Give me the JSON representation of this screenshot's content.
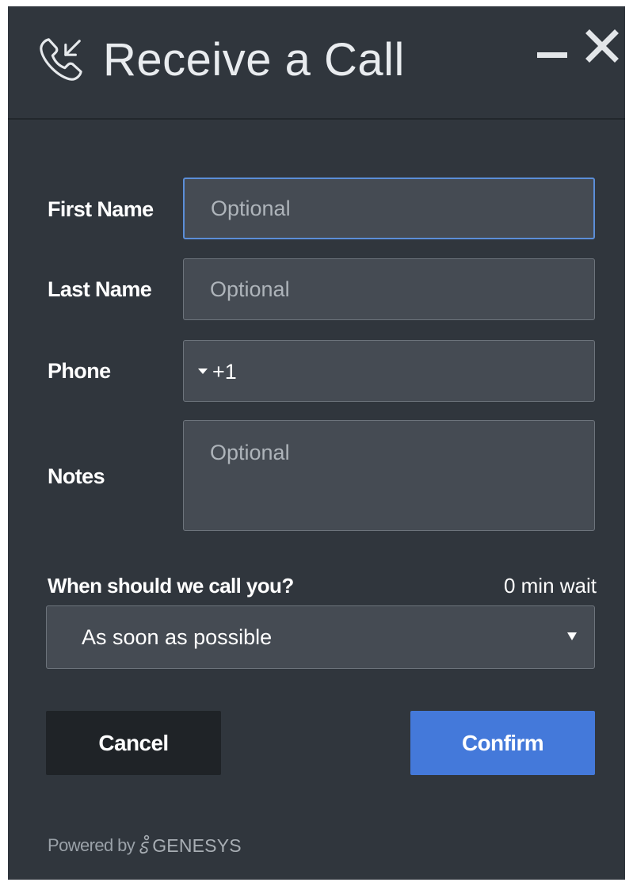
{
  "window": {
    "title": "Receive a Call",
    "minimize_icon": "minimize-icon",
    "close_icon": "close-icon",
    "title_icon": "phone-incoming-icon"
  },
  "form": {
    "first_name": {
      "label": "First Name",
      "placeholder": "Optional",
      "value": ""
    },
    "last_name": {
      "label": "Last Name",
      "placeholder": "Optional",
      "value": ""
    },
    "phone": {
      "label": "Phone",
      "country_code": "+1",
      "value": ""
    },
    "notes": {
      "label": "Notes",
      "placeholder": "Optional",
      "value": ""
    },
    "schedule": {
      "label": "When should we call you?",
      "wait_text": "0 min wait",
      "selected": "As soon as possible"
    }
  },
  "actions": {
    "cancel_label": "Cancel",
    "confirm_label": "Confirm"
  },
  "footer": {
    "powered_by": "Powered by",
    "brand": "GENESYS"
  },
  "colors": {
    "background": "#30363d",
    "field": "#454b53",
    "focus_border": "#5b8ed8",
    "confirm": "#4479da",
    "cancel": "#1f2327"
  }
}
